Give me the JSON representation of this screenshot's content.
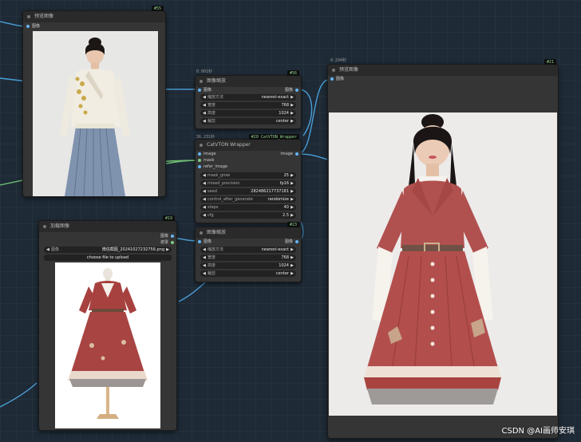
{
  "nodes": {
    "preview_top": {
      "badge": "#55",
      "title": "预览图像",
      "input_label": "图像"
    },
    "resize_top": {
      "timing": "0.001秒",
      "badge": "#56",
      "title": "图像缩放",
      "input_label": "图像",
      "output_label": "图像",
      "widgets": [
        {
          "label": "缩放方法",
          "value": "nearest-exact"
        },
        {
          "label": "宽度",
          "value": "768"
        },
        {
          "label": "高度",
          "value": "1024"
        },
        {
          "label": "裁剪",
          "value": "center"
        }
      ]
    },
    "catvton": {
      "timing": "36.231秒",
      "badge": "#20 CatVTON_Wrapper",
      "title": "CatVTON Wrapper",
      "inputs": [
        "image",
        "mask",
        "refer_image"
      ],
      "output_label": "image",
      "widgets": [
        {
          "label": "mask_grow",
          "value": "25"
        },
        {
          "label": "mixed_precision",
          "value": "fp16"
        },
        {
          "label": "seed",
          "value": "282486217737181"
        },
        {
          "label": "control_after_generate",
          "value": "randomize"
        },
        {
          "label": "steps",
          "value": "40"
        },
        {
          "label": "cfg",
          "value": "2.5"
        }
      ]
    },
    "load_image": {
      "badge": "#19",
      "title": "加载图像",
      "outputs": [
        "图像",
        "遮罩"
      ],
      "file_label": "图像",
      "file_value": "微信截图_20241027232756.png",
      "upload_button": "choose file to upload"
    },
    "resize_bottom": {
      "badge": "#23",
      "title": "图像缩放",
      "input_label": "图像",
      "output_label": "图像",
      "widgets": [
        {
          "label": "缩放方法",
          "value": "nearest-exact"
        },
        {
          "label": "宽度",
          "value": "768"
        },
        {
          "label": "高度",
          "value": "1024"
        },
        {
          "label": "裁剪",
          "value": "center"
        }
      ]
    },
    "preview_right": {
      "timing": "0.294秒",
      "badge": "#21",
      "title": "预览图像",
      "input_label": "图像"
    }
  },
  "watermark": "CSDN @AI画师安琪",
  "colors": {
    "image_port": "#64b5f6",
    "mask_port": "#81c784",
    "link": "#4a9fd8",
    "mask_link": "#6fbf73"
  }
}
